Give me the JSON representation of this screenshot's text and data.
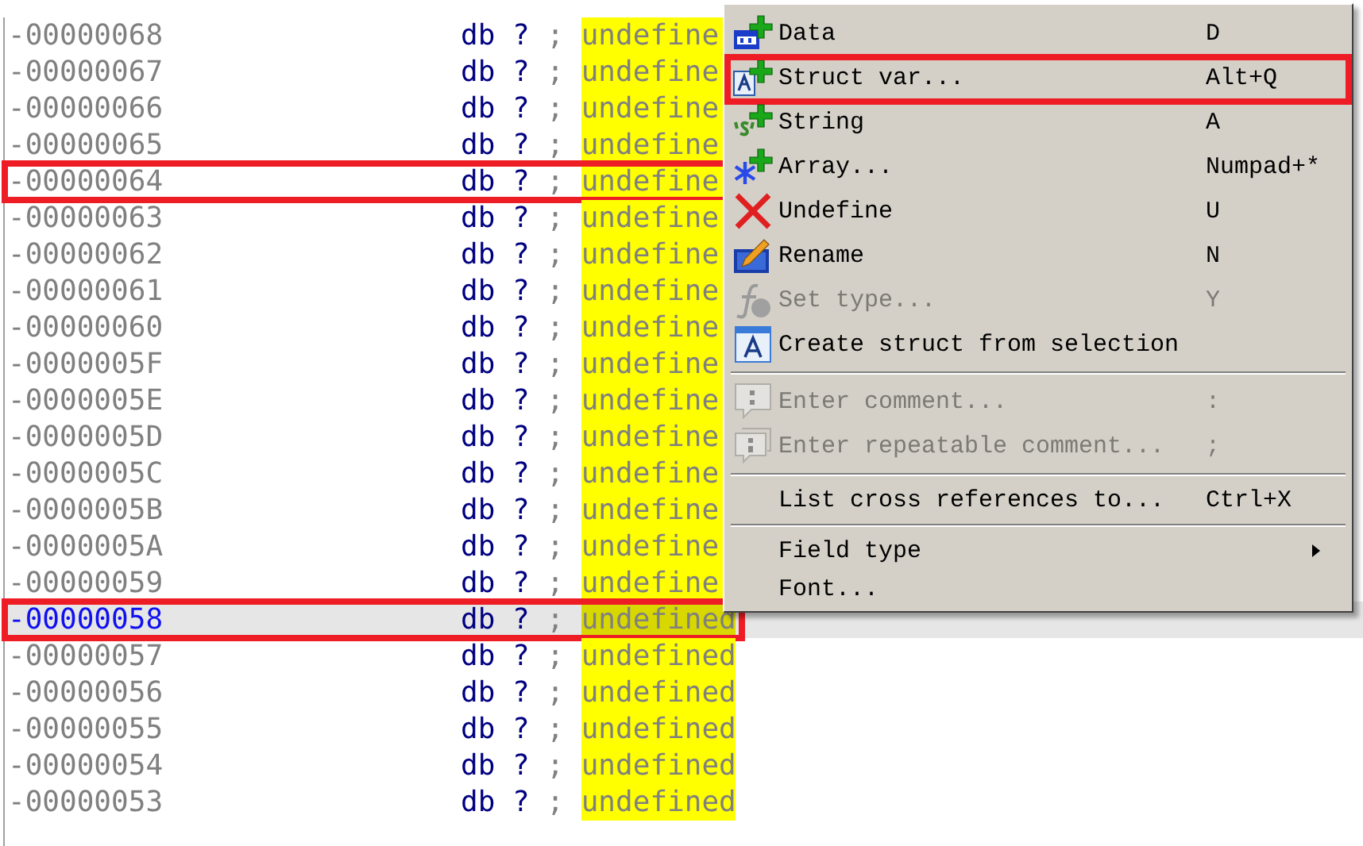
{
  "listing": {
    "rows": [
      {
        "address": "-00000068",
        "type": "db",
        "value": "?",
        "separator": ";",
        "comment": "undefine",
        "selected": false,
        "annotated": false
      },
      {
        "address": "-00000067",
        "type": "db",
        "value": "?",
        "separator": ";",
        "comment": "undefine",
        "selected": false,
        "annotated": false
      },
      {
        "address": "-00000066",
        "type": "db",
        "value": "?",
        "separator": ";",
        "comment": "undefine",
        "selected": false,
        "annotated": false
      },
      {
        "address": "-00000065",
        "type": "db",
        "value": "?",
        "separator": ";",
        "comment": "undefine",
        "selected": false,
        "annotated": false
      },
      {
        "address": "-00000064",
        "type": "db",
        "value": "?",
        "separator": ";",
        "comment": "undefine",
        "selected": false,
        "annotated": true
      },
      {
        "address": "-00000063",
        "type": "db",
        "value": "?",
        "separator": ";",
        "comment": "undefine",
        "selected": false,
        "annotated": false
      },
      {
        "address": "-00000062",
        "type": "db",
        "value": "?",
        "separator": ";",
        "comment": "undefine",
        "selected": false,
        "annotated": false
      },
      {
        "address": "-00000061",
        "type": "db",
        "value": "?",
        "separator": ";",
        "comment": "undefine",
        "selected": false,
        "annotated": false
      },
      {
        "address": "-00000060",
        "type": "db",
        "value": "?",
        "separator": ";",
        "comment": "undefine",
        "selected": false,
        "annotated": false
      },
      {
        "address": "-0000005F",
        "type": "db",
        "value": "?",
        "separator": ";",
        "comment": "undefine",
        "selected": false,
        "annotated": false
      },
      {
        "address": "-0000005E",
        "type": "db",
        "value": "?",
        "separator": ";",
        "comment": "undefine",
        "selected": false,
        "annotated": false
      },
      {
        "address": "-0000005D",
        "type": "db",
        "value": "?",
        "separator": ";",
        "comment": "undefine",
        "selected": false,
        "annotated": false
      },
      {
        "address": "-0000005C",
        "type": "db",
        "value": "?",
        "separator": ";",
        "comment": "undefine",
        "selected": false,
        "annotated": false
      },
      {
        "address": "-0000005B",
        "type": "db",
        "value": "?",
        "separator": ";",
        "comment": "undefine",
        "selected": false,
        "annotated": false
      },
      {
        "address": "-0000005A",
        "type": "db",
        "value": "?",
        "separator": ";",
        "comment": "undefine",
        "selected": false,
        "annotated": false
      },
      {
        "address": "-00000059",
        "type": "db",
        "value": "?",
        "separator": ";",
        "comment": "undefine",
        "selected": false,
        "annotated": false
      },
      {
        "address": "-00000058",
        "type": "db",
        "value": "?",
        "separator": ";",
        "comment": "undefined",
        "selected": true,
        "annotated": true
      },
      {
        "address": "-00000057",
        "type": "db",
        "value": "?",
        "separator": ";",
        "comment": "undefined",
        "selected": false,
        "annotated": false
      },
      {
        "address": "-00000056",
        "type": "db",
        "value": "?",
        "separator": ";",
        "comment": "undefined",
        "selected": false,
        "annotated": false
      },
      {
        "address": "-00000055",
        "type": "db",
        "value": "?",
        "separator": ";",
        "comment": "undefined",
        "selected": false,
        "annotated": false
      },
      {
        "address": "-00000054",
        "type": "db",
        "value": "?",
        "separator": ";",
        "comment": "undefined",
        "selected": false,
        "annotated": false
      },
      {
        "address": "-00000053",
        "type": "db",
        "value": "?",
        "separator": ";",
        "comment": "undefined",
        "selected": false,
        "annotated": false
      }
    ]
  },
  "context_menu": {
    "items": [
      {
        "kind": "item",
        "label": "Data",
        "shortcut": "D",
        "disabled": false,
        "annotated": false
      },
      {
        "kind": "item",
        "label": "Struct var...",
        "shortcut": "Alt+Q",
        "disabled": false,
        "annotated": true
      },
      {
        "kind": "item",
        "label": "String",
        "shortcut": "A",
        "disabled": false,
        "annotated": false
      },
      {
        "kind": "item",
        "label": "Array...",
        "shortcut": "Numpad+*",
        "disabled": false,
        "annotated": false
      },
      {
        "kind": "item",
        "label": "Undefine",
        "shortcut": "U",
        "disabled": false,
        "annotated": false
      },
      {
        "kind": "item",
        "label": "Rename",
        "shortcut": "N",
        "disabled": false,
        "annotated": false
      },
      {
        "kind": "item",
        "label": "Set type...",
        "shortcut": "Y",
        "disabled": true,
        "annotated": false
      },
      {
        "kind": "item",
        "label": "Create struct from selection",
        "disabled": false,
        "annotated": false
      },
      {
        "kind": "separator"
      },
      {
        "kind": "item",
        "label": "Enter comment...",
        "shortcut": ":",
        "disabled": true,
        "annotated": false
      },
      {
        "kind": "item",
        "label": "Enter repeatable comment...",
        "shortcut": ";",
        "disabled": true,
        "annotated": false
      },
      {
        "kind": "separator"
      },
      {
        "kind": "item",
        "label": "List cross references to...",
        "shortcut": "Ctrl+X",
        "disabled": false,
        "annotated": false
      },
      {
        "kind": "separator"
      },
      {
        "kind": "item",
        "label": "Field type",
        "disabled": false,
        "annotated": false,
        "submenu": true
      },
      {
        "kind": "item",
        "label": "Font...",
        "disabled": false,
        "annotated": false
      }
    ]
  }
}
